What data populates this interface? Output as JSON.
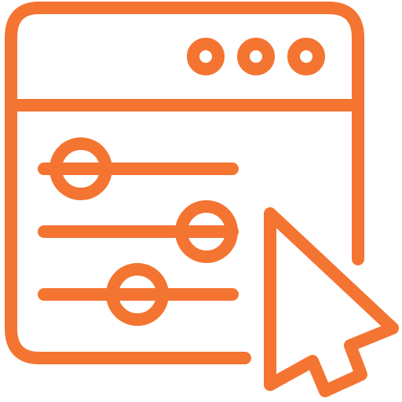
{
  "icon": {
    "name": "settings-sliders-window-cursor-icon",
    "stroke_color": "#F47432",
    "background_color": "#FFFFFF"
  },
  "window": {
    "title_bar_controls": [
      "window-dot-icon",
      "window-dot-icon",
      "window-dot-icon"
    ]
  },
  "sliders": [
    {
      "name": "slider-1",
      "knob_position": 0.2
    },
    {
      "name": "slider-2",
      "knob_position": 0.83
    },
    {
      "name": "slider-3",
      "knob_position": 0.45
    }
  ],
  "cursor": {
    "name": "pointer-cursor-icon"
  }
}
